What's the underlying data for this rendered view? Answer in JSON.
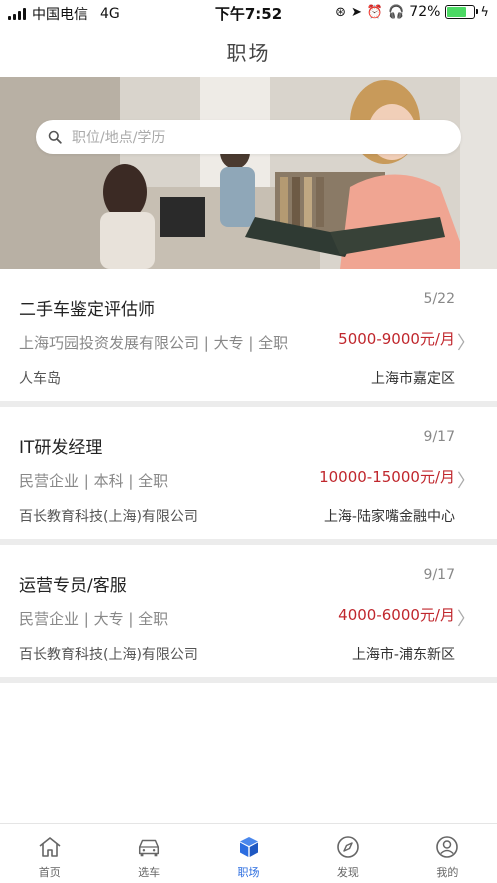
{
  "status_bar": {
    "carrier": "中国电信",
    "network": "4G",
    "time": "下午7:52",
    "battery_percent": "72%",
    "battery_level": 0.72
  },
  "header": {
    "title": "职场"
  },
  "search": {
    "placeholder": "职位/地点/学历"
  },
  "jobs": [
    {
      "title": "二手车鉴定评估师",
      "date": "5/22",
      "meta": "上海巧园投资发展有限公司 | 大专 | 全职",
      "salary": "5000-9000元/月",
      "company": "人车岛",
      "location": "上海市嘉定区"
    },
    {
      "title": "IT研发经理",
      "date": "9/17",
      "meta": "民营企业 | 本科 | 全职",
      "salary": "10000-15000元/月",
      "company": "百长教育科技(上海)有限公司",
      "location": "上海-陆家嘴金融中心"
    },
    {
      "title": "运营专员/客服",
      "date": "9/17",
      "meta": "民营企业 | 大专 | 全职",
      "salary": "4000-6000元/月",
      "company": "百长教育科技(上海)有限公司",
      "location": "上海市-浦东新区"
    }
  ],
  "tabs": [
    {
      "label": "首页",
      "icon": "home-icon",
      "active": false
    },
    {
      "label": "选车",
      "icon": "car-icon",
      "active": false
    },
    {
      "label": "职场",
      "icon": "cube-icon",
      "active": true
    },
    {
      "label": "发现",
      "icon": "compass-icon",
      "active": false
    },
    {
      "label": "我的",
      "icon": "user-icon",
      "active": false
    }
  ],
  "colors": {
    "accent": "#2b6de0",
    "salary": "#c0272d",
    "battery": "#4cd964"
  }
}
